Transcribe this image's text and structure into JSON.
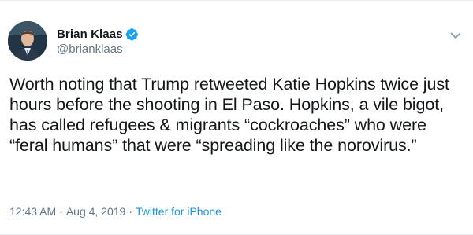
{
  "tweet": {
    "author": {
      "display_name": "Brian Klaas",
      "handle": "@brianklaas",
      "verified": true,
      "avatar_icon": "profile-photo"
    },
    "menu_icon": "chevron-down-icon",
    "text": "Worth noting that Trump retweeted Katie Hopkins twice just hours before the shooting in El Paso. Hopkins, a vile bigot, has called refugees & migrants “cockroaches” who were “feral humans” that were “spreading like the norovirus.”",
    "time": "12:43 AM",
    "separator": "·",
    "date": "Aug 4, 2019",
    "source": "Twitter for iPhone",
    "colors": {
      "text": "#14171a",
      "secondary": "#657786",
      "link": "#1b95e0",
      "verified": "#1da1f2"
    }
  }
}
